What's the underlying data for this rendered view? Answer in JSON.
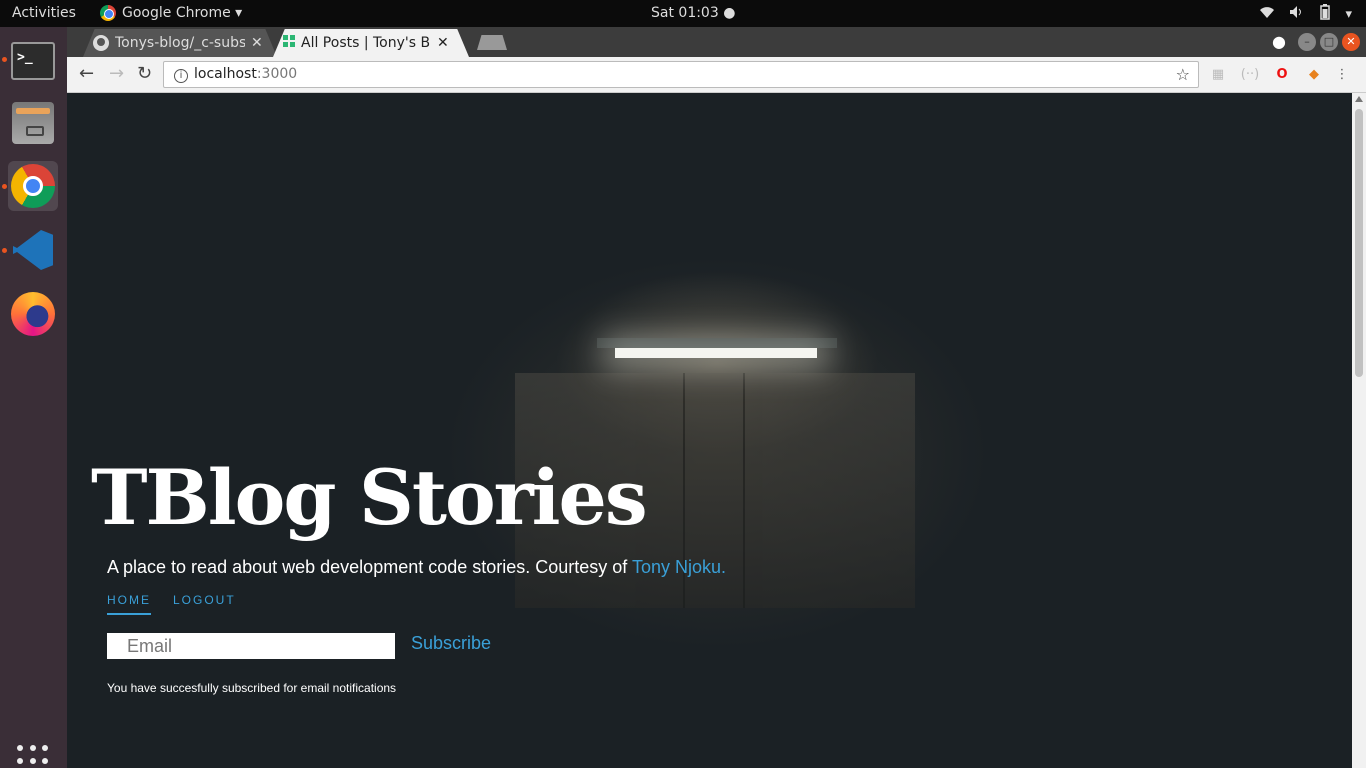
{
  "topbar": {
    "activities": "Activities",
    "app_menu": "Google Chrome ▾",
    "clock": "Sat 01:03 ●"
  },
  "browser": {
    "tabs": [
      {
        "title": "Tonys-blog/_c-subs"
      },
      {
        "title": "All Posts | Tony's Blo"
      }
    ],
    "url_host": "localhost",
    "url_port": ":3000"
  },
  "page": {
    "hero_title": "TBlog Stories",
    "tagline": "A place to read about web development code stories. Courtesy of ",
    "author_link": "Tony Njoku.",
    "nav": [
      {
        "label": "HOME",
        "active": true
      },
      {
        "label": "LOGOUT",
        "active": false
      }
    ],
    "email_placeholder": "Email",
    "subscribe_label": "Subscribe",
    "status_message": "You have succesfully subscribed for email notifications"
  },
  "colors": {
    "accent": "#3aa0d8",
    "page_bg": "#1b2125",
    "dock_bg": "#3a2e37",
    "ubuntu_orange": "#e95420"
  }
}
